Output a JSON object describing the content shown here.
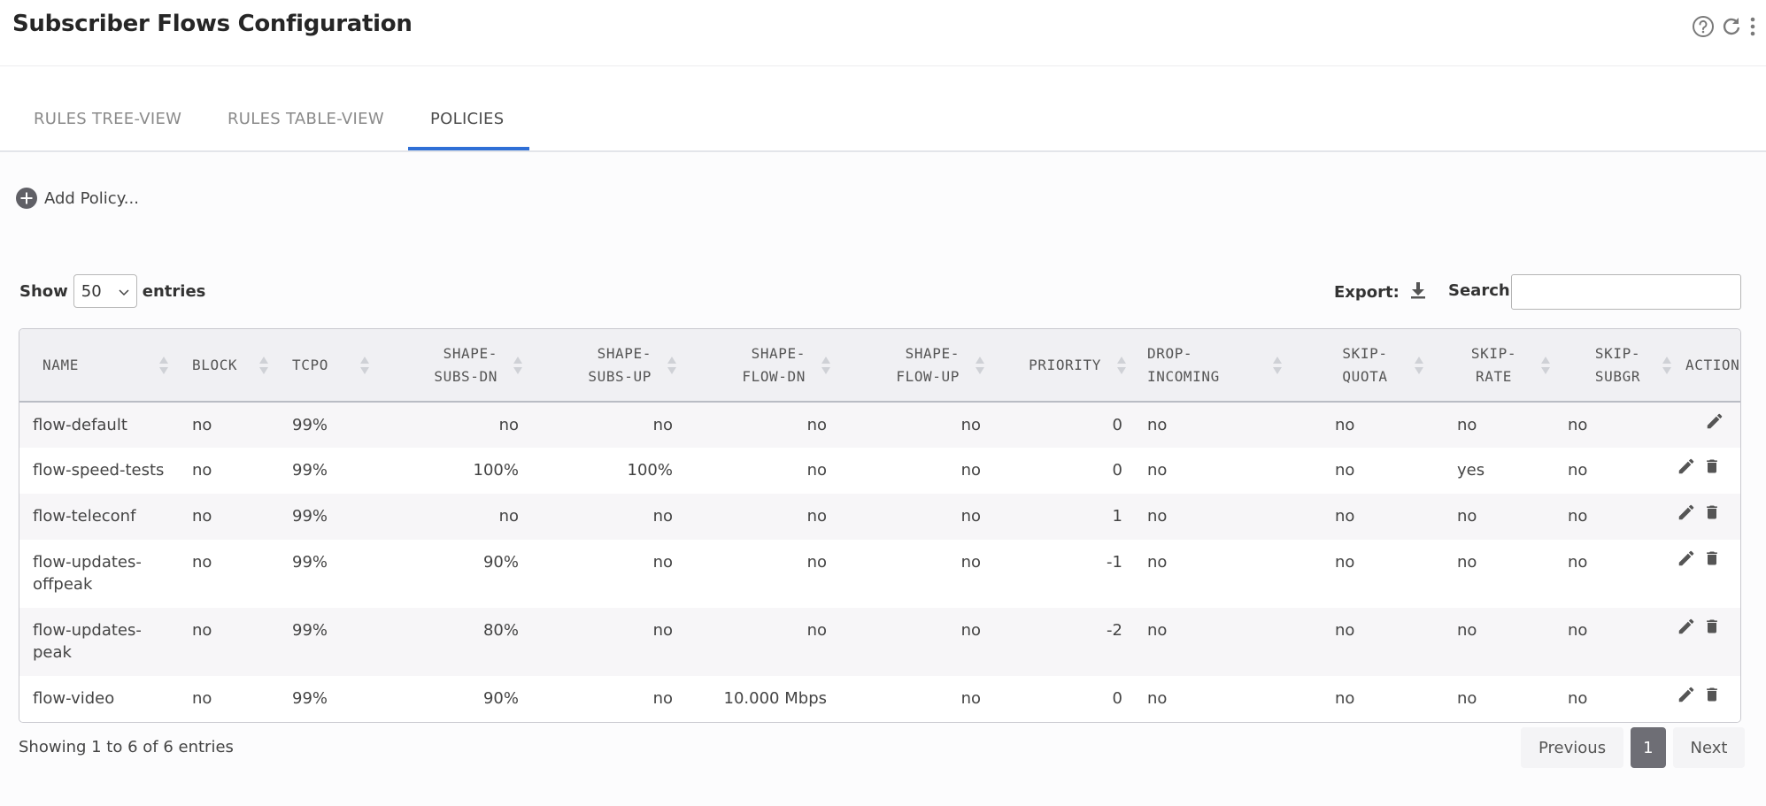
{
  "header": {
    "title": "Subscriber Flows Configuration",
    "icons": [
      "help-icon",
      "refresh-icon",
      "more-vert-icon"
    ]
  },
  "tabs": [
    {
      "label": "RULES TREE-VIEW",
      "active": false
    },
    {
      "label": "RULES TABLE-VIEW",
      "active": false
    },
    {
      "label": "POLICIES",
      "active": true
    }
  ],
  "toolbar": {
    "add_policy_label": "Add Policy...",
    "show_label": "Show",
    "entries_value": "50",
    "entries_label": "entries",
    "export_label": "Export:",
    "search_label": "Search:",
    "search_value": ""
  },
  "table": {
    "columns": [
      {
        "line1": "NAME",
        "line2": ""
      },
      {
        "line1": "BLOCK",
        "line2": ""
      },
      {
        "line1": "TCPO",
        "line2": ""
      },
      {
        "line1": "SHAPE-",
        "line2": "SUBS-DN"
      },
      {
        "line1": "SHAPE-",
        "line2": "SUBS-UP"
      },
      {
        "line1": "SHAPE-",
        "line2": "FLOW-DN"
      },
      {
        "line1": "SHAPE-",
        "line2": "FLOW-UP"
      },
      {
        "line1": "PRIORITY",
        "line2": ""
      },
      {
        "line1": "DROP-",
        "line2": "INCOMING"
      },
      {
        "line1": "SKIP-",
        "line2": "QUOTA"
      },
      {
        "line1": "SKIP-",
        "line2": "RATE"
      },
      {
        "line1": "SKIP-",
        "line2": "SUBGR"
      },
      {
        "line1": "ACTIONS",
        "line2": ""
      }
    ],
    "rows": [
      {
        "name_l1": "flow-default",
        "name_l2": "",
        "block": "no",
        "tcpo": "99%",
        "subs_dn": "no",
        "subs_up": "no",
        "flow_dn": "no",
        "flow_up": "no",
        "priority": "0",
        "drop_incoming": "no",
        "skip_quota": "no",
        "skip_rate": "no",
        "skip_subgr": "no",
        "deletable": false
      },
      {
        "name_l1": "flow-speed-tests",
        "name_l2": "",
        "block": "no",
        "tcpo": "99%",
        "subs_dn": "100%",
        "subs_up": "100%",
        "flow_dn": "no",
        "flow_up": "no",
        "priority": "0",
        "drop_incoming": "no",
        "skip_quota": "no",
        "skip_rate": "yes",
        "skip_subgr": "no",
        "deletable": true
      },
      {
        "name_l1": "flow-teleconf",
        "name_l2": "",
        "block": "no",
        "tcpo": "99%",
        "subs_dn": "no",
        "subs_up": "no",
        "flow_dn": "no",
        "flow_up": "no",
        "priority": "1",
        "drop_incoming": "no",
        "skip_quota": "no",
        "skip_rate": "no",
        "skip_subgr": "no",
        "deletable": true
      },
      {
        "name_l1": "flow-updates-",
        "name_l2": "offpeak",
        "block": "no",
        "tcpo": "99%",
        "subs_dn": "90%",
        "subs_up": "no",
        "flow_dn": "no",
        "flow_up": "no",
        "priority": "-1",
        "drop_incoming": "no",
        "skip_quota": "no",
        "skip_rate": "no",
        "skip_subgr": "no",
        "deletable": true
      },
      {
        "name_l1": "flow-updates-",
        "name_l2": "peak",
        "block": "no",
        "tcpo": "99%",
        "subs_dn": "80%",
        "subs_up": "no",
        "flow_dn": "no",
        "flow_up": "no",
        "priority": "-2",
        "drop_incoming": "no",
        "skip_quota": "no",
        "skip_rate": "no",
        "skip_subgr": "no",
        "deletable": true
      },
      {
        "name_l1": "flow-video",
        "name_l2": "",
        "block": "no",
        "tcpo": "99%",
        "subs_dn": "90%",
        "subs_up": "no",
        "flow_dn": "10.000 Mbps",
        "flow_up": "no",
        "priority": "0",
        "drop_incoming": "no",
        "skip_quota": "no",
        "skip_rate": "no",
        "skip_subgr": "no",
        "deletable": true
      }
    ]
  },
  "footer": {
    "info": "Showing 1 to 6 of 6 entries",
    "previous_label": "Previous",
    "current_page": "1",
    "next_label": "Next"
  },
  "colors": {
    "accent": "#2f6fd6",
    "pager_active": "#6e6e75",
    "icon": "#555555"
  }
}
